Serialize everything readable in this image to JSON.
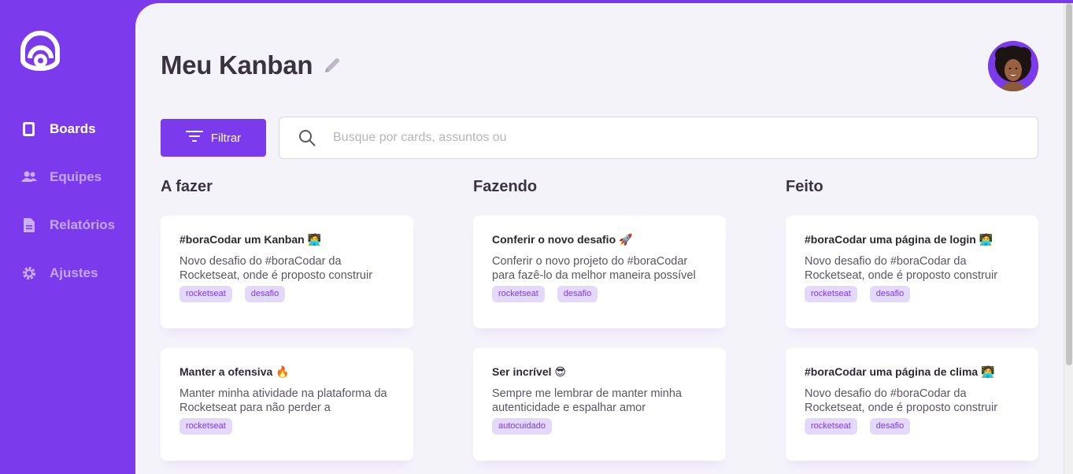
{
  "app": {
    "title": "Meu Kanban",
    "accent_color": "#7c3aed",
    "logo": "rocketseat-logo"
  },
  "sidebar": {
    "items": [
      {
        "label": "Boards",
        "icon": "book-icon",
        "active": true
      },
      {
        "label": "Equipes",
        "icon": "users-icon",
        "active": false
      },
      {
        "label": "Relatórios",
        "icon": "file-icon",
        "active": false
      },
      {
        "label": "Ajustes",
        "icon": "gear-icon",
        "active": false
      }
    ]
  },
  "header": {
    "title": "Meu Kanban",
    "edit_icon": "pencil-icon",
    "avatar": "user-avatar"
  },
  "toolbar": {
    "filter_label": "Filtrar",
    "search_placeholder": "Busque por cards, assuntos ou"
  },
  "columns": [
    {
      "title": "A fazer",
      "cards": [
        {
          "title": "#boraCodar um Kanban 🧑‍💻",
          "description": "Novo desafio do #boraCodar da Rocketseat, onde é proposto construir",
          "tags": [
            "rocketseat",
            "desafio"
          ]
        },
        {
          "title": "Manter a ofensiva 🔥",
          "description": "Manter minha atividade na plataforma da Rocketseat para não perder a",
          "tags": [
            "rocketseat"
          ]
        }
      ]
    },
    {
      "title": "Fazendo",
      "cards": [
        {
          "title": "Conferir o novo desafio 🚀",
          "description": "Conferir o novo projeto do #boraCodar para fazê-lo da melhor maneira possível",
          "tags": [
            "rocketseat",
            "desafio"
          ]
        },
        {
          "title": "Ser incrível 😎",
          "description": "Sempre me lembrar de manter minha autenticidade e espalhar amor",
          "tags": [
            "autocuidado"
          ]
        }
      ]
    },
    {
      "title": "Feito",
      "cards": [
        {
          "title": "#boraCodar uma página de login 🧑‍💻",
          "description": "Novo desafio do #boraCodar da Rocketseat, onde é proposto construir",
          "tags": [
            "rocketseat",
            "desafio"
          ]
        },
        {
          "title": "#boraCodar uma página de clima 🧑‍💻",
          "description": "Novo desafio do #boraCodar da Rocketseat, onde é proposto construir",
          "tags": [
            "rocketseat",
            "desafio"
          ]
        }
      ]
    }
  ]
}
